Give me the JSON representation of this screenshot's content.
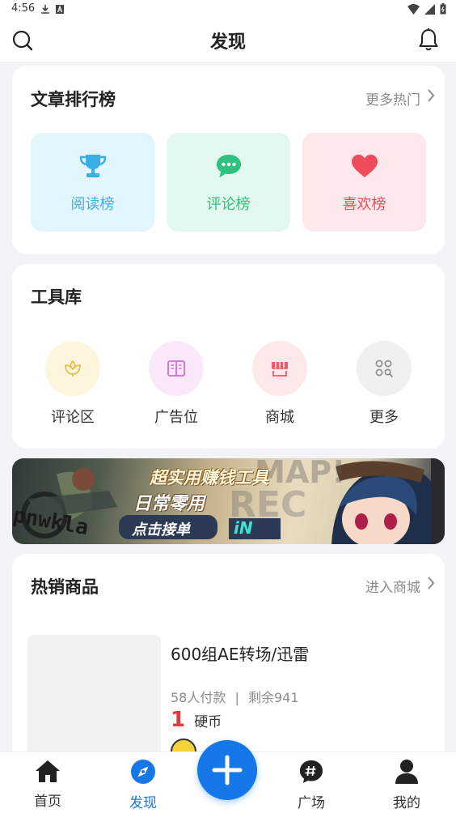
{
  "status_bar": {
    "time": "4:56"
  },
  "header": {
    "title": "发现"
  },
  "ranking": {
    "title": "文章排行榜",
    "more": "更多热门",
    "items": [
      {
        "label": "阅读榜",
        "icon": "trophy-icon",
        "color": "#3aaee8",
        "bg": "#e3f5fd"
      },
      {
        "label": "评论榜",
        "icon": "chat-icon",
        "color": "#2ec27e",
        "bg": "#e3f8ee"
      },
      {
        "label": "喜欢榜",
        "icon": "heart-icon",
        "color": "#ef4b5a",
        "bg": "#fde9ec"
      }
    ]
  },
  "tools": {
    "title": "工具库",
    "items": [
      {
        "label": "评论区",
        "icon": "flower-icon",
        "color": "#e6b93a",
        "bg": "#fdf6dc"
      },
      {
        "label": "广告位",
        "icon": "book-icon",
        "color": "#d56bd8",
        "bg": "#fbe9fb"
      },
      {
        "label": "商城",
        "icon": "store-icon",
        "color": "#ee5a6a",
        "bg": "#fde8ea"
      },
      {
        "label": "更多",
        "icon": "grid-search-icon",
        "color": "#8a8a8a",
        "bg": "#f0f0f0"
      }
    ]
  },
  "banner": {
    "headline": "超实用赚钱工具",
    "subline": "日常零用",
    "cta": "点击接单",
    "tag": "iN"
  },
  "hot": {
    "title": "热销商品",
    "more": "进入商城",
    "product": {
      "name": "600组AE转场/迅雷",
      "paid": "58人付款",
      "remaining": "剩余941",
      "price": "1",
      "unit": "硬币"
    }
  },
  "nav": {
    "items": [
      {
        "label": "首页",
        "active": false
      },
      {
        "label": "发现",
        "active": true
      },
      {
        "label": "广场",
        "active": false
      },
      {
        "label": "我的",
        "active": false
      }
    ]
  },
  "colors": {
    "accent": "#1677e8",
    "price": "#e03a3a"
  }
}
